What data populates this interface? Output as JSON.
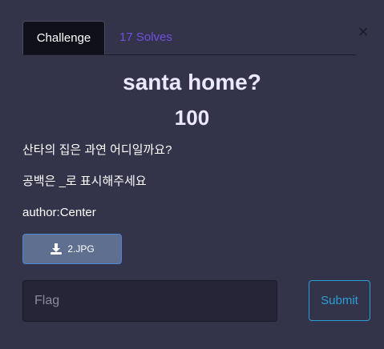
{
  "tabs": {
    "challenge_label": "Challenge",
    "solves_label": "17 Solves"
  },
  "close_symbol": "×",
  "challenge": {
    "name": "santa home?",
    "value": "100",
    "description_lines": [
      "산타의 집은 과연 어디일까요?",
      "공백은 _로 표시해주세요",
      "author:Center"
    ]
  },
  "file": {
    "icon": "download-icon",
    "label": "2.JPG"
  },
  "flag": {
    "placeholder": "Flag",
    "value": ""
  },
  "submit_label": "Submit",
  "colors": {
    "background": "#33334a",
    "active_tab_bg": "#10101a",
    "solves_tab": "#6f4fe0",
    "file_button_bg": "#5f6f8f",
    "submit_accent": "#2a9fd6"
  }
}
